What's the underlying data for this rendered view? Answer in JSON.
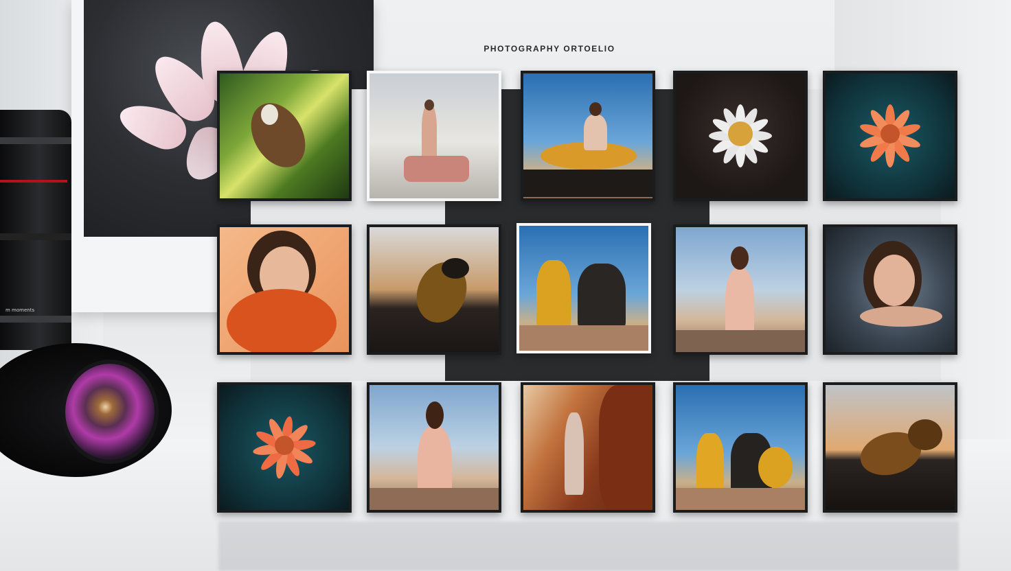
{
  "page": {
    "title": "PHOTOGRAPHY ORTOELIO"
  },
  "camera": {
    "body_markings": [
      "",
      "",
      "m moments"
    ]
  },
  "gallery": {
    "rows": 3,
    "columns": 5,
    "photos": [
      {
        "subject": "insect on green leaves",
        "icon": "insect-photo-icon"
      },
      {
        "subject": "woman standing on beach",
        "icon": "portrait-photo-icon"
      },
      {
        "subject": "woman seated in yellow dress",
        "icon": "portrait-photo-icon"
      },
      {
        "subject": "white flower",
        "icon": "flower-photo-icon"
      },
      {
        "subject": "orange flower on teal leaves",
        "icon": "flower-photo-icon"
      },
      {
        "subject": "woman in orange scarf",
        "icon": "portrait-photo-icon"
      },
      {
        "subject": "draped figure at dusk",
        "icon": "sculpture-photo-icon"
      },
      {
        "subject": "two women on rocks",
        "icon": "portrait-photo-icon"
      },
      {
        "subject": "woman in pink gown",
        "icon": "portrait-photo-icon"
      },
      {
        "subject": "woman in grey swirl",
        "icon": "portrait-photo-icon"
      },
      {
        "subject": "red flower on teal leaves",
        "icon": "flower-photo-icon"
      },
      {
        "subject": "woman in gown on rocks",
        "icon": "portrait-photo-icon"
      },
      {
        "subject": "woman by canyon rock",
        "icon": "portrait-photo-icon"
      },
      {
        "subject": "two women seated",
        "icon": "portrait-photo-icon"
      },
      {
        "subject": "bronze sculpture at sunset",
        "icon": "sculpture-photo-icon"
      }
    ]
  },
  "colors": {
    "wall": "#eef0f2",
    "center_strip": "#2a2b2d",
    "camera_red": "#b2121a",
    "frame": "#1b1c1e"
  }
}
